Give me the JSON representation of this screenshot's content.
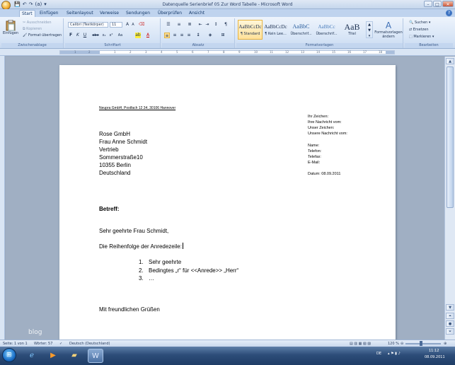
{
  "window": {
    "title": "Datenquelle Serienbrief 05 Zur Word Tabelle - Microsoft Word",
    "qat": [
      "💾",
      "↶",
      "↷",
      "(a)",
      "▾"
    ],
    "controls": [
      "–",
      "□",
      "✕"
    ]
  },
  "tabs": [
    "Start",
    "Einfügen",
    "Seitenlayout",
    "Verweise",
    "Sendungen",
    "Überprüfen",
    "Ansicht"
  ],
  "ribbon": {
    "clipboard": {
      "paste": "Einfügen",
      "cut": "Ausschneiden",
      "copy": "Kopieren",
      "format_painter": "Format übertragen",
      "label": "Zwischenablage"
    },
    "font": {
      "name": "Calibri (Textkörper)",
      "size": "11",
      "bold": "F",
      "italic": "K",
      "underline": "U",
      "strike": "abe",
      "sub": "x₂",
      "sup": "x²",
      "case": "Aa",
      "grow": "A",
      "shrink": "A",
      "label": "Schriftart"
    },
    "paragraph": {
      "label": "Absatz",
      "pilcrow": "¶"
    },
    "styles": {
      "items": [
        {
          "sample": "AaBbCcDc",
          "name": "¶ Standard"
        },
        {
          "sample": "AaBbCcDc",
          "name": "¶ Kein Lee..."
        },
        {
          "sample": "AaBbC",
          "name": "Überschrif..."
        },
        {
          "sample": "AaBbCc",
          "name": "Überschrif..."
        },
        {
          "sample": "AaB",
          "name": "Titel"
        }
      ],
      "change_styles": "Formatvorlagen ändern",
      "label": "Formatvorlagen"
    },
    "editing": {
      "find": "Suchen",
      "replace": "Ersetzen",
      "select": "Markieren",
      "label": "Bearbeiten"
    }
  },
  "ruler": {
    "ticks": [
      "1",
      "2",
      "1",
      "2",
      "3",
      "4",
      "5",
      "6",
      "7",
      "8",
      "9",
      "10",
      "11",
      "12",
      "13",
      "14",
      "15",
      "16",
      "17",
      "18"
    ]
  },
  "document": {
    "sender_line": "Neupra GmbH, Postfach 12 34, 30106 Hannover",
    "address": [
      "Rose GmbH",
      "Frau Anne Schmidt",
      "Vertrieb",
      "Sommerstraße10",
      "10355 Berlin",
      "Deutschland"
    ],
    "info_block": [
      "Ihr Zeichen:",
      "Ihre Nachricht vom:",
      "Unser Zeichen:",
      "Unsere Nachricht vom:"
    ],
    "contact_block": [
      "Name:",
      "Telefon:",
      "Telefax:",
      "E-Mail:"
    ],
    "date": "Datum: 08.09.2011",
    "subject": "Betreff:",
    "salutation": "Sehr geehrte Frau Schmidt,",
    "body": "Die Reihenfolge der Anredezeile:",
    "list": [
      {
        "num": "1.",
        "text": "Sehr geehrte"
      },
      {
        "num": "2.",
        "text": "Bedingtes „r“ für <<Anrede>> „Herr“"
      },
      {
        "num": "3.",
        "text": "…"
      }
    ],
    "closing": "Mit freundlichen Grüßen"
  },
  "watermark": "blog",
  "statusbar": {
    "page": "Seite: 1 von 1",
    "words": "Wörter: 57",
    "language": "Deutsch (Deutschland)",
    "zoom": "120 %"
  },
  "taskbar": {
    "lang": "DE",
    "time": "11:12",
    "date": "08.09.2011"
  }
}
